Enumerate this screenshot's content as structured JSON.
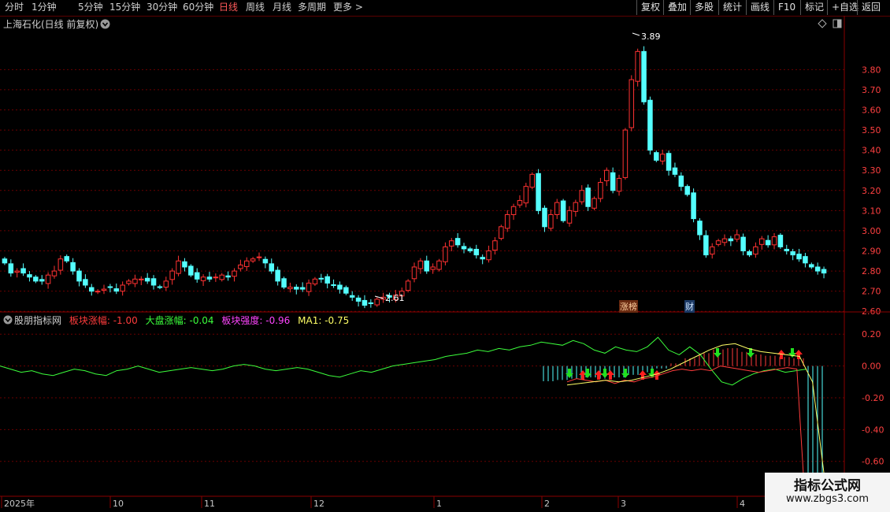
{
  "toolbar": {
    "periods": [
      "分时",
      "1分钟",
      "5分钟",
      "15分钟",
      "30分钟",
      "60分钟",
      "日线",
      "周线",
      "月线",
      "多周期",
      "更多 >"
    ],
    "active_period": "日线",
    "right_buttons": [
      "复权",
      "叠加",
      "多股",
      "统计",
      "画线",
      "F10",
      "标记",
      "+自选",
      "返回"
    ]
  },
  "main_chart": {
    "title": "上海石化(日线 前复权)",
    "high_label": "3.89",
    "low_label": "2.61",
    "events": [
      "涨榜",
      "财"
    ],
    "colors": {
      "up": "#ff3232",
      "down": "#54ffff",
      "grid": "#6a0000"
    }
  },
  "indicator": {
    "name": "股朋指标网",
    "items": [
      {
        "label": "板块涨幅:",
        "value": "-1.00",
        "color": "#ff3c3c"
      },
      {
        "label": "大盘涨幅:",
        "value": "-0.04",
        "color": "#3cff3c"
      },
      {
        "label": "板块强度:",
        "value": "-0.96",
        "color": "#ff44ff"
      },
      {
        "label": "MA1:",
        "value": "-0.75",
        "color": "#ffff66"
      }
    ]
  },
  "x_axis": {
    "labels": [
      "2025年",
      "10",
      "11",
      "12",
      "1",
      "2",
      "3",
      "4"
    ]
  },
  "watermark": {
    "logo": "指标公式网",
    "url": "www.zbgs3.com"
  },
  "chart_data": [
    {
      "type": "candlestick",
      "title": "上海石化(日线 前复权)",
      "ylim": [
        2.55,
        3.95
      ],
      "y_ticks": [
        2.6,
        2.7,
        2.8,
        2.9,
        3.0,
        3.1,
        3.2,
        3.3,
        3.4,
        3.5,
        3.6,
        3.7,
        3.8
      ],
      "close": [
        2.84,
        2.79,
        2.8,
        2.79,
        2.77,
        2.75,
        2.75,
        2.78,
        2.8,
        2.86,
        2.85,
        2.8,
        2.75,
        2.73,
        2.7,
        2.7,
        2.71,
        2.72,
        2.7,
        2.73,
        2.75,
        2.76,
        2.76,
        2.75,
        2.73,
        2.72,
        2.75,
        2.8,
        2.85,
        2.82,
        2.78,
        2.76,
        2.77,
        2.76,
        2.77,
        2.78,
        2.77,
        2.8,
        2.83,
        2.85,
        2.86,
        2.87,
        2.84,
        2.8,
        2.75,
        2.72,
        2.72,
        2.71,
        2.71,
        2.74,
        2.76,
        2.76,
        2.74,
        2.73,
        2.71,
        2.69,
        2.67,
        2.65,
        2.63,
        2.64,
        2.66,
        2.67,
        2.67,
        2.68,
        2.7,
        2.75,
        2.82,
        2.85,
        2.8,
        2.82,
        2.85,
        2.92,
        2.95,
        2.93,
        2.91,
        2.9,
        2.88,
        2.86,
        2.9,
        2.95,
        3.02,
        3.08,
        3.12,
        3.15,
        3.22,
        3.28,
        3.1,
        3.02,
        3.08,
        3.14,
        3.05,
        3.1,
        3.14,
        3.2,
        3.12,
        3.16,
        3.24,
        3.3,
        3.2,
        3.26,
        3.5,
        3.75,
        3.89,
        3.64,
        3.4,
        3.35,
        3.38,
        3.3,
        3.28,
        3.22,
        3.18,
        3.06,
        2.98,
        2.88,
        2.92,
        2.95,
        2.96,
        2.95,
        2.98,
        2.9,
        2.88,
        2.92,
        2.96,
        2.93,
        2.97,
        2.92,
        2.9,
        2.88,
        2.86,
        2.84,
        2.82,
        2.8,
        2.79
      ]
    },
    {
      "type": "line",
      "title": "股朋指标网",
      "ylim": [
        -0.75,
        0.3
      ],
      "y_ticks": [
        0.2,
        0.0,
        -0.2,
        -0.4,
        -0.6
      ],
      "series": [
        {
          "name": "大盘涨幅",
          "values": [
            0.0,
            -0.02,
            -0.04,
            -0.03,
            -0.05,
            -0.06,
            -0.04,
            -0.02,
            -0.03,
            -0.05,
            -0.06,
            -0.03,
            -0.02,
            0.0,
            -0.02,
            -0.04,
            -0.03,
            -0.02,
            -0.01,
            -0.02,
            -0.03,
            -0.02,
            0.0,
            0.01,
            0.0,
            -0.02,
            -0.03,
            -0.02,
            -0.01,
            -0.02,
            -0.04,
            -0.06,
            -0.07,
            -0.05,
            -0.03,
            -0.04,
            -0.02,
            0.0,
            0.01,
            0.02,
            0.03,
            0.04,
            0.06,
            0.07,
            0.08,
            0.1,
            0.09,
            0.11,
            0.1,
            0.12,
            0.13,
            0.15,
            0.14,
            0.13,
            0.16,
            0.14,
            0.1,
            0.08,
            0.12,
            0.1,
            0.09,
            0.12,
            0.18,
            0.1,
            0.07,
            0.12,
            0.07,
            -0.02,
            -0.1,
            -0.12,
            -0.08,
            -0.05,
            -0.03,
            -0.02,
            -0.04,
            -0.03,
            -0.02
          ]
        },
        {
          "name": "板块涨幅",
          "values": [
            -0.1,
            -0.08,
            -0.09,
            -0.1,
            -0.09,
            -0.11,
            -0.09,
            -0.1,
            -0.08,
            -0.07,
            -0.05,
            -0.03,
            -0.02,
            -0.03,
            -0.02,
            -0.03,
            0.0,
            -0.01,
            -0.02,
            -0.03,
            -0.04,
            -0.03,
            -0.02,
            -0.01,
            -0.02,
            -1.0
          ]
        },
        {
          "name": "MA1",
          "values": [
            -0.12,
            -0.11,
            -0.1,
            -0.09,
            -0.1,
            -0.09,
            -0.07,
            -0.05,
            -0.02,
            0.02,
            0.06,
            0.1,
            0.13,
            0.14,
            0.11,
            0.09,
            0.08,
            0.07,
            0.06,
            -0.1,
            -0.75
          ]
        }
      ]
    }
  ]
}
